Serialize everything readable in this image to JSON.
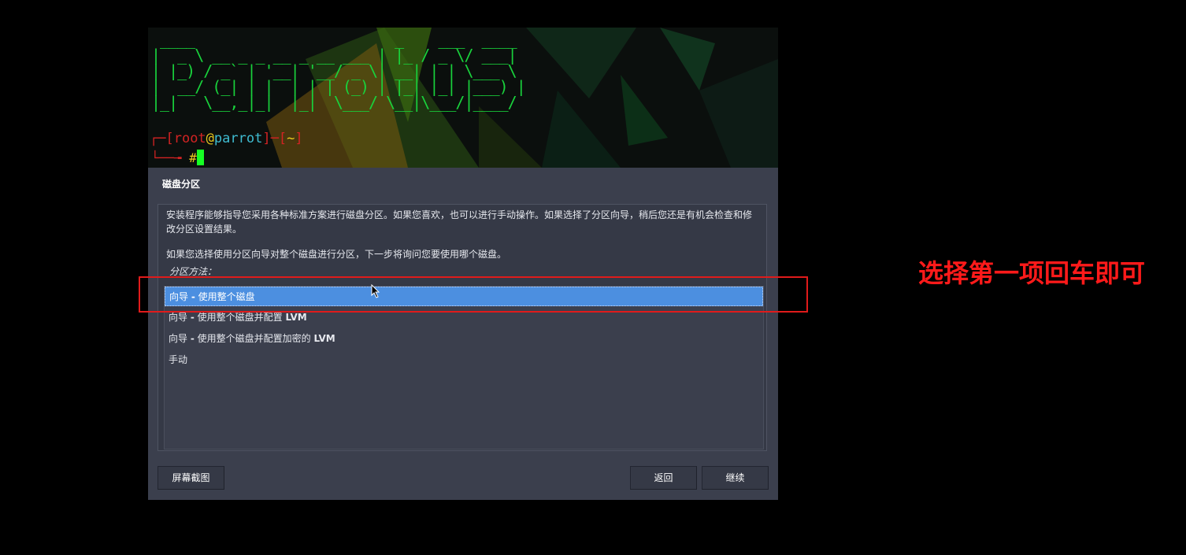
{
  "terminal": {
    "ascii_logo": " ____                       _    ___  ____\n|  _ \\ __ _ _ __ _ __ ___ | |_ / _ \\/ ___|\n| |_) / _` | '__| '__/ _ \\| __| | | \\___ \\\n|  __/ (_| | |  | | | (_) | |_| |_| |___) |\n|_|   \\__,_|_|  |_|  \\___/ \\__|\\___/|____/",
    "prompt_open": "┌─[",
    "prompt_user": "root",
    "prompt_at": "@",
    "prompt_host": "parrot",
    "prompt_mid": "]─[",
    "prompt_dir": "~",
    "prompt_close": "]",
    "prompt_arrow": "└──╼ ",
    "prompt_hash": "#"
  },
  "dialog": {
    "title": "磁盘分区",
    "para1": "安装程序能够指导您采用各种标准方案进行磁盘分区。如果您喜欢，也可以进行手动操作。如果选择了分区向导，稍后您还是有机会检查和修改分区设置结果。",
    "para2": "如果您选择使用分区向导对整个磁盘进行分区，下一步将询问您要使用哪个磁盘。",
    "method_label": "分区方法：",
    "options": [
      {
        "prefix": "向导 ",
        "dash": "-",
        "text": " 使用整个磁盘",
        "suffix": ""
      },
      {
        "prefix": "向导 ",
        "dash": "-",
        "text": " 使用整个磁盘并配置 ",
        "suffix": "LVM"
      },
      {
        "prefix": "向导 ",
        "dash": "-",
        "text": " 使用整个磁盘并配置加密的 ",
        "suffix": "LVM"
      },
      {
        "prefix": "手动",
        "dash": "",
        "text": "",
        "suffix": ""
      }
    ],
    "selected_index": 0,
    "buttons": {
      "screenshot": "屏幕截图",
      "back": "返回",
      "continue": "继续"
    }
  },
  "annotation": {
    "text": "选择第一项回车即可",
    "color": "#ff1a1a"
  },
  "colors": {
    "dialog_bg": "#3b3f4d",
    "selection": "#4c8fe0",
    "terminal_green": "#19d23c"
  }
}
